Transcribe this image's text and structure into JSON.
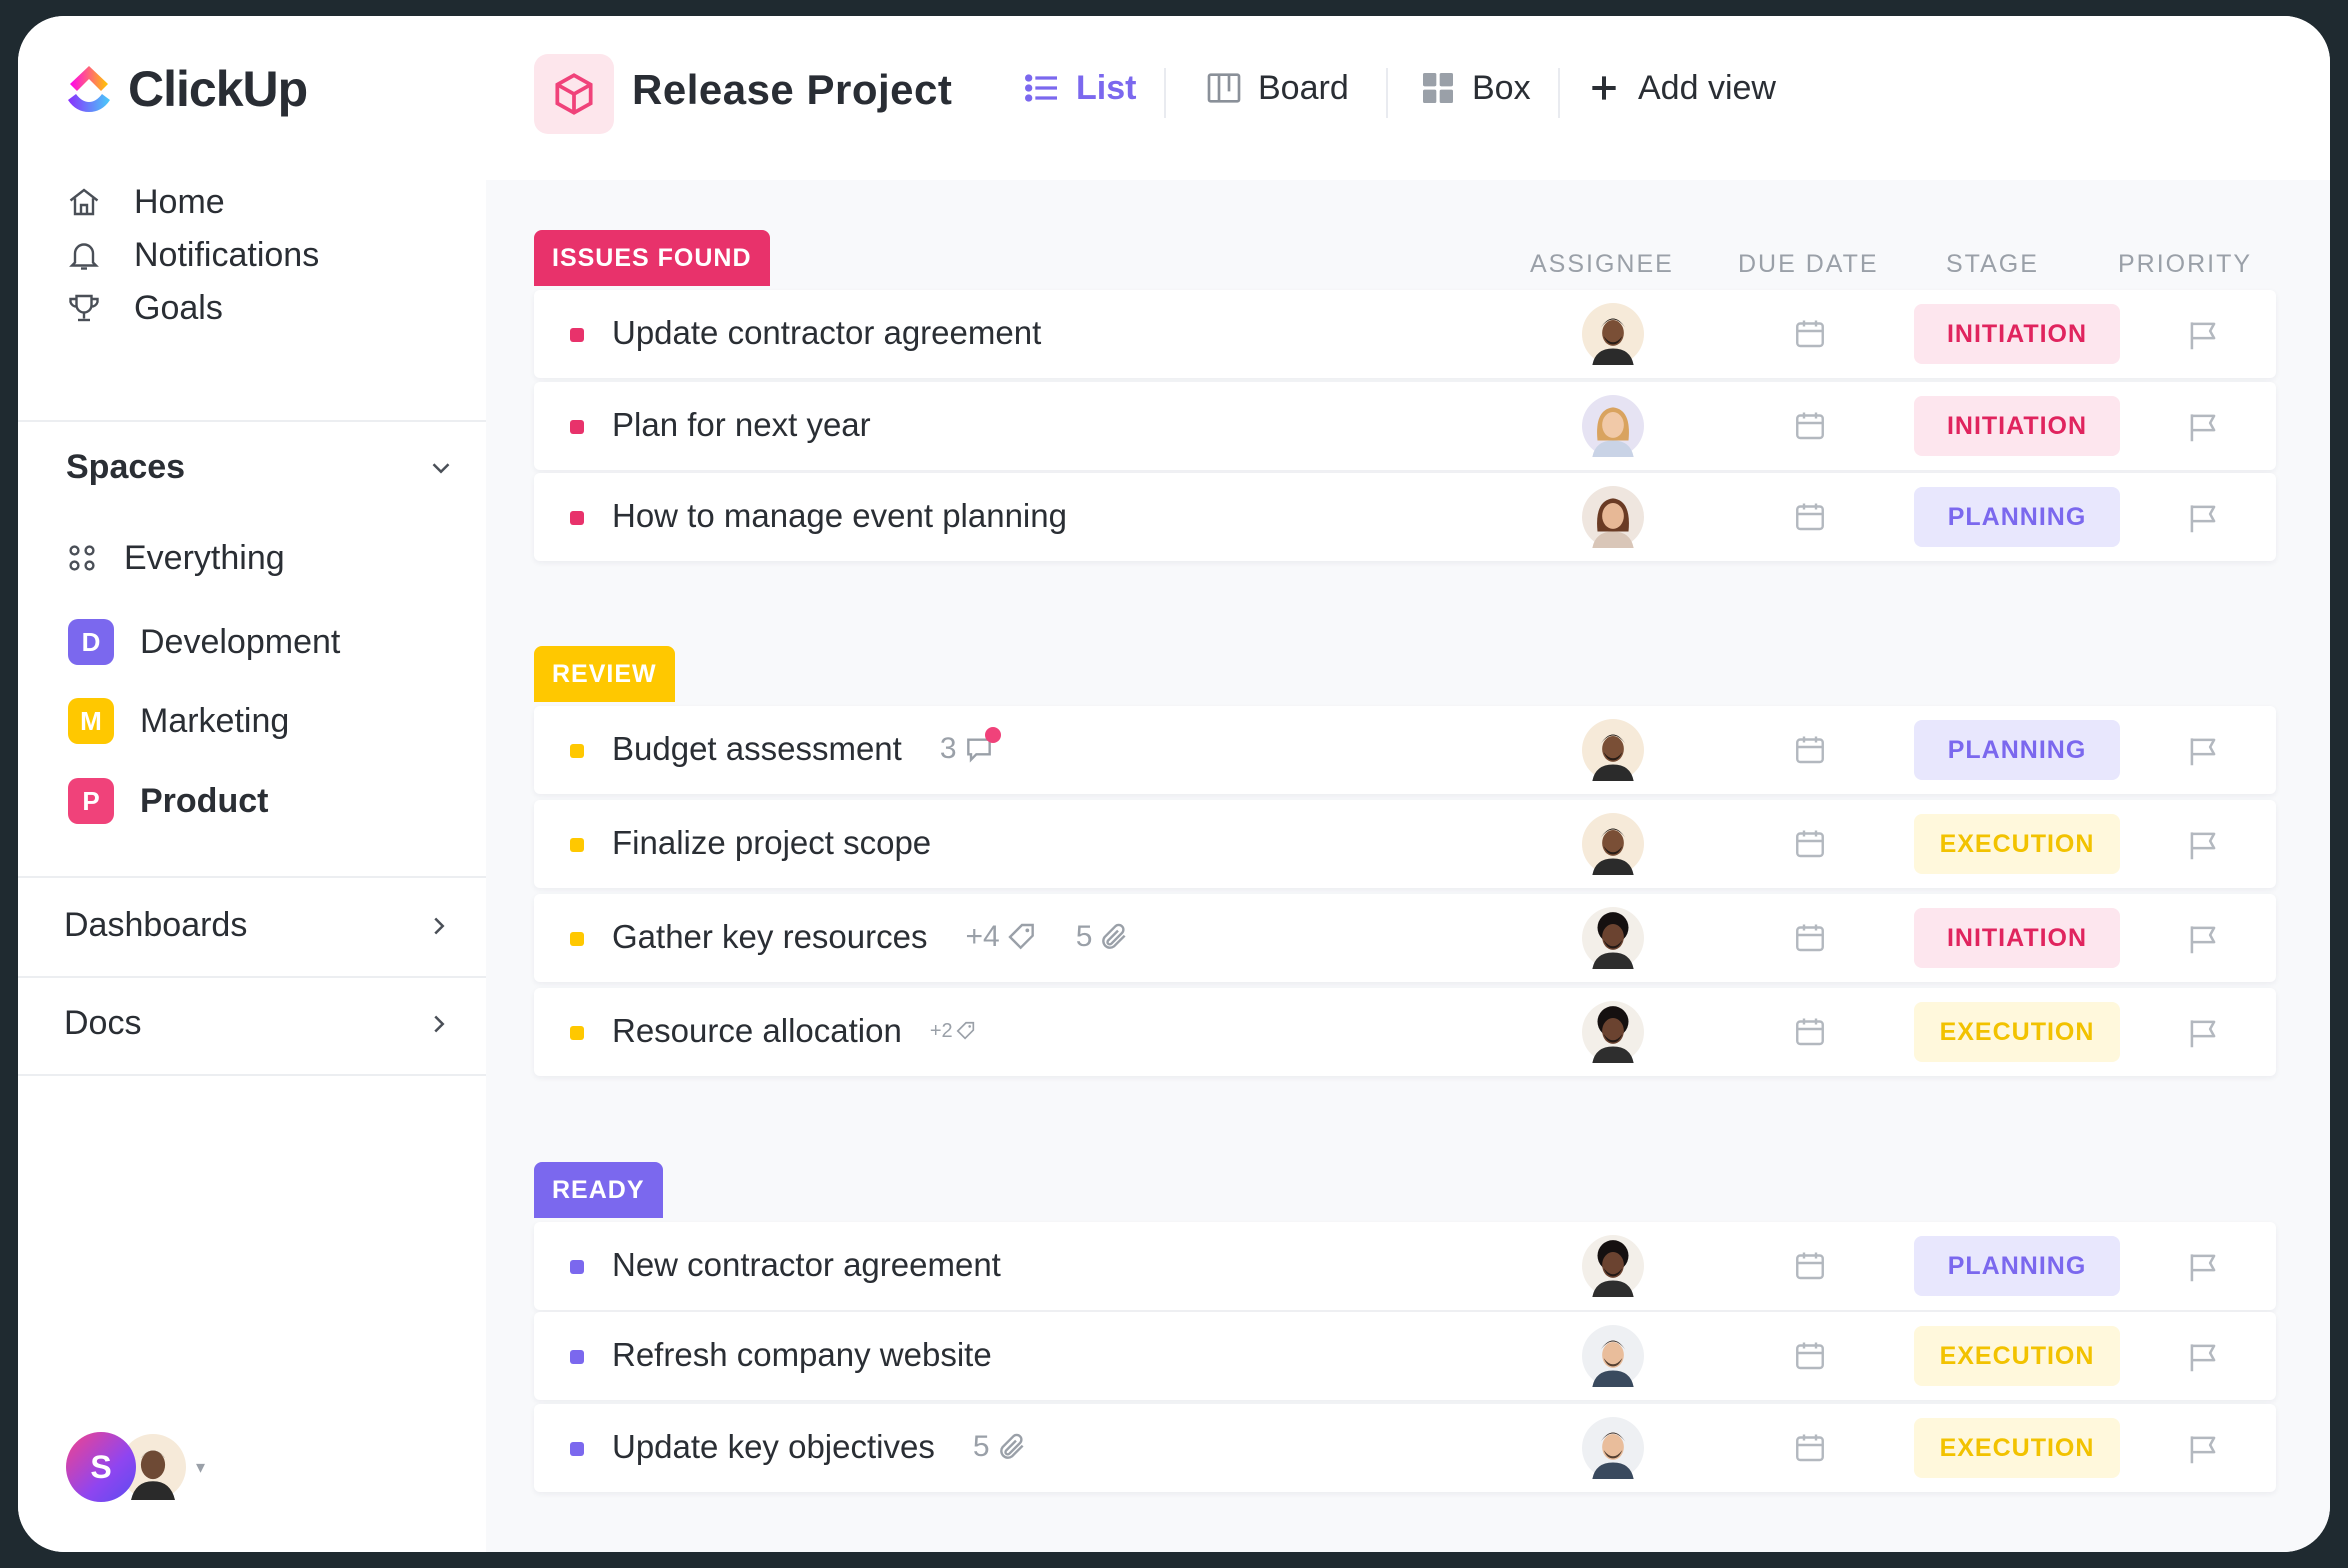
{
  "app": {
    "name": "ClickUp"
  },
  "sidebar": {
    "nav": [
      {
        "label": "Home",
        "icon": "home-icon"
      },
      {
        "label": "Notifications",
        "icon": "bell-icon"
      },
      {
        "label": "Goals",
        "icon": "trophy-icon"
      }
    ],
    "spaces_label": "Spaces",
    "everything_label": "Everything",
    "spaces": [
      {
        "letter": "D",
        "label": "Development",
        "color": "#7b68ee"
      },
      {
        "letter": "M",
        "label": "Marketing",
        "color": "#ffc800"
      },
      {
        "letter": "P",
        "label": "Product",
        "color": "#f0427a",
        "active": true
      }
    ],
    "dashboards_label": "Dashboards",
    "docs_label": "Docs",
    "user_initial": "S"
  },
  "header": {
    "project_title": "Release Project",
    "views": [
      {
        "label": "List",
        "icon": "list-icon",
        "active": true
      },
      {
        "label": "Board",
        "icon": "board-icon"
      },
      {
        "label": "Box",
        "icon": "box-grid-icon"
      },
      {
        "label": "Add view",
        "icon": "plus-icon"
      }
    ]
  },
  "columns": {
    "assignee": "ASSIGNEE",
    "due_date": "DUE DATE",
    "stage": "STAGE",
    "priority": "PRIORITY"
  },
  "colors": {
    "issues": "#e8326b",
    "review": "#ffc800",
    "ready": "#7b68ee"
  },
  "groups": [
    {
      "label": "ISSUES FOUND",
      "color": "#e8326b",
      "tasks": [
        {
          "name": "Update contractor agreement",
          "stage": "INITIATION"
        },
        {
          "name": "Plan for next year",
          "stage": "INITIATION"
        },
        {
          "name": "How to manage event planning",
          "stage": "PLANNING"
        }
      ]
    },
    {
      "label": "REVIEW",
      "color": "#ffc800",
      "tasks": [
        {
          "name": "Budget assessment",
          "comments": "3",
          "stage": "PLANNING"
        },
        {
          "name": "Finalize project scope",
          "stage": "EXECUTION"
        },
        {
          "name": "Gather key resources",
          "tags": "+4",
          "attachments": "5",
          "stage": "INITIATION"
        },
        {
          "name": "Resource allocation",
          "tags": "+2",
          "stage": "EXECUTION"
        }
      ]
    },
    {
      "label": "READY",
      "color": "#7b68ee",
      "tasks": [
        {
          "name": "New contractor agreement",
          "stage": "PLANNING"
        },
        {
          "name": "Refresh company website",
          "stage": "EXECUTION"
        },
        {
          "name": "Update key objectives",
          "attachments": "5",
          "stage": "EXECUTION"
        }
      ]
    }
  ]
}
